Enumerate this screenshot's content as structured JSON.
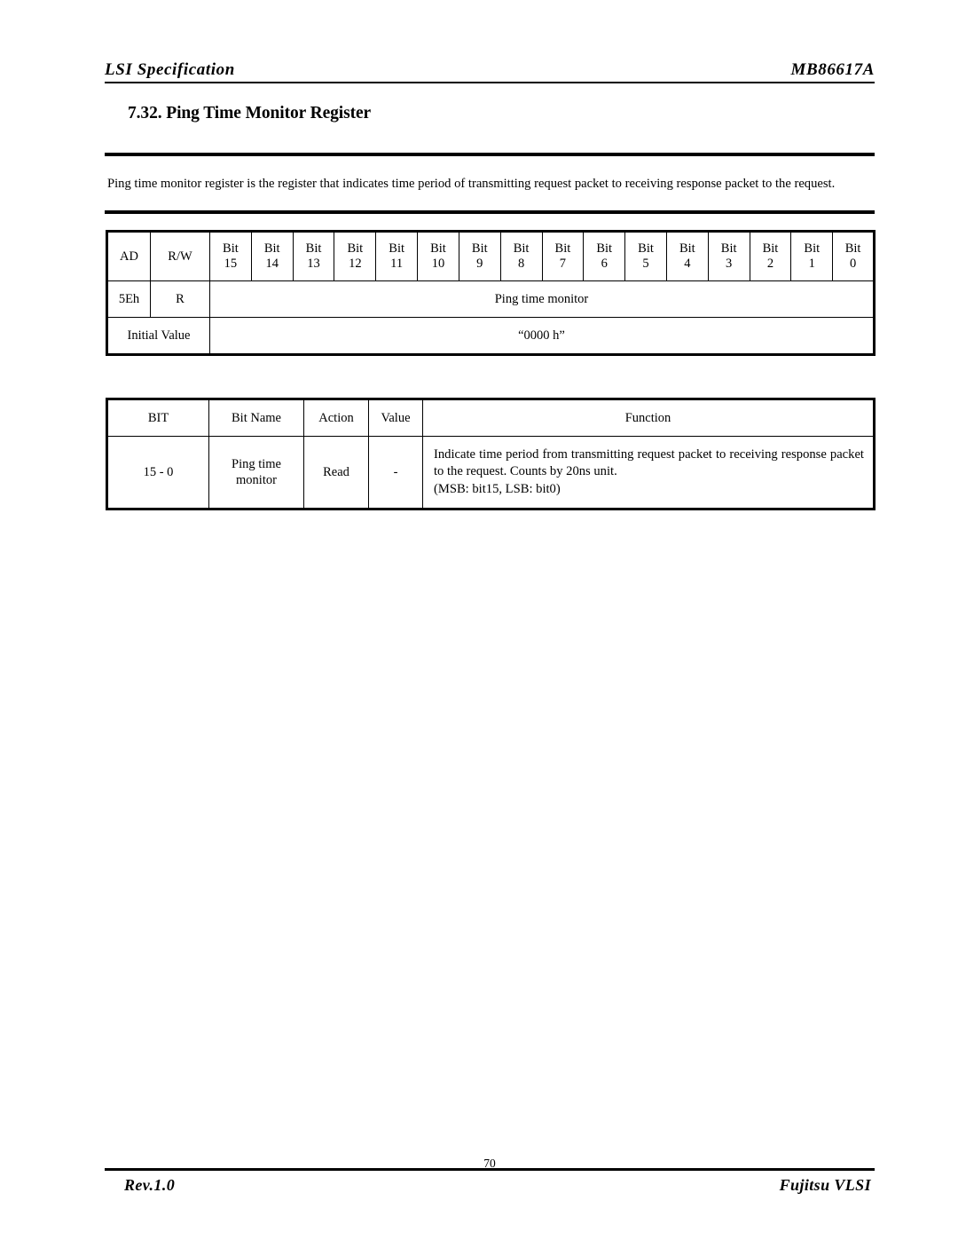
{
  "header": {
    "left": "LSI Specification",
    "right": "MB86617A"
  },
  "section": {
    "title": "7.32. Ping Time Monitor Register"
  },
  "intro": {
    "text": "Ping time monitor register is the register that indicates time period of transmitting request packet to receiving response packet to the request."
  },
  "register_table": {
    "head": {
      "ad": "AD",
      "rw": "R/W",
      "bit_word": "Bit",
      "bit_numbers": [
        "15",
        "14",
        "13",
        "12",
        "11",
        "10",
        "9",
        "8",
        "7",
        "6",
        "5",
        "4",
        "3",
        "2",
        "1",
        "0"
      ]
    },
    "rows": [
      {
        "address": "5Eh",
        "rw": "R",
        "span_label": "Ping time monitor"
      },
      {
        "label": "Initial Value",
        "span_label": "“0000 h”"
      }
    ]
  },
  "bit_detail_table": {
    "headers": [
      "BIT",
      "Bit Name",
      "Action",
      "Value",
      "Function"
    ],
    "rows": [
      {
        "bit": "15 - 0",
        "name_line1": "Ping time",
        "name_line2": "monitor",
        "action": "Read",
        "value": "-",
        "function_line1": "Indicate time period from transmitting request packet to receiving response packet",
        "function_line2": "to the request.  Counts by 20ns unit.",
        "function_line3": "(MSB: bit15, LSB: bit0)"
      }
    ]
  },
  "footer": {
    "left": "Rev.1.0",
    "page": "70",
    "right": "Fujitsu VLSI"
  }
}
